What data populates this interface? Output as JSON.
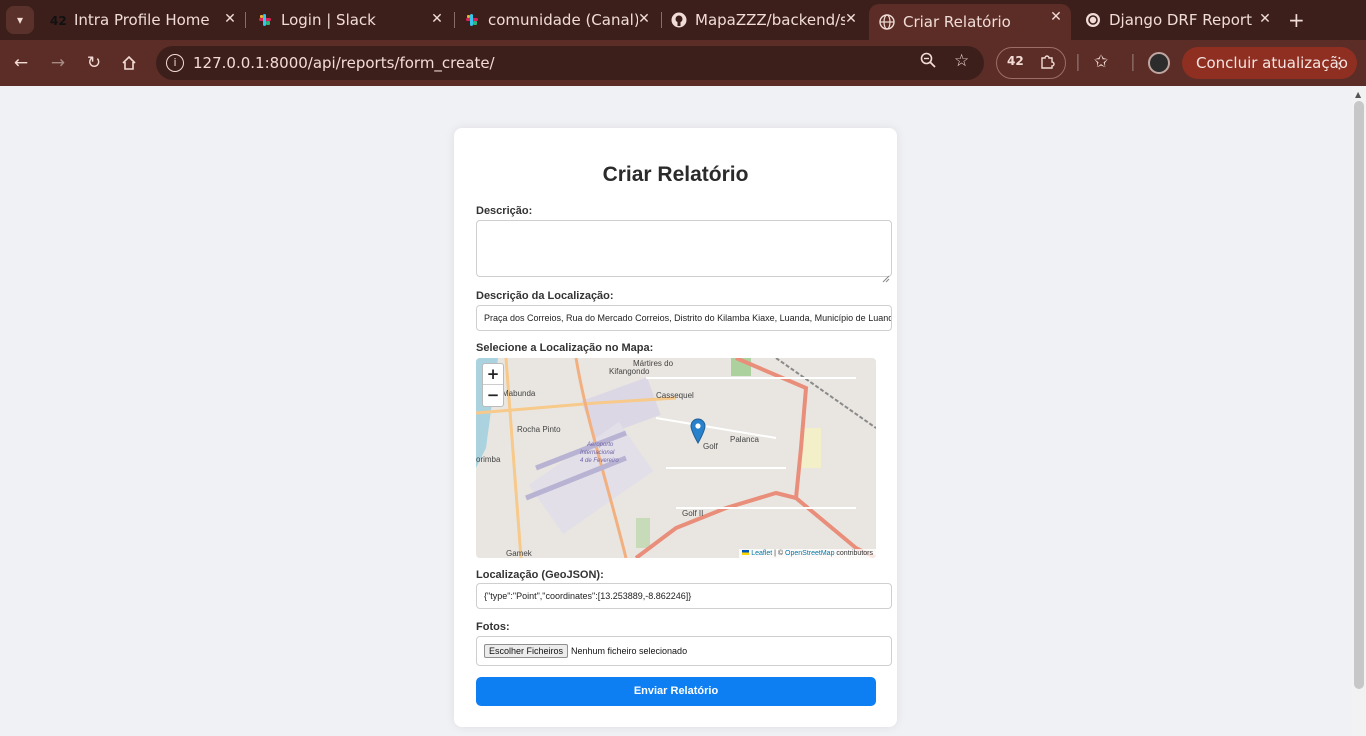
{
  "browser": {
    "tabs": [
      {
        "title": "Intra Profile Home",
        "icon": "42-icon"
      },
      {
        "title": "Login | Slack",
        "icon": "slack-icon"
      },
      {
        "title": "comunidade (Canal)",
        "icon": "slack-icon"
      },
      {
        "title": "MapaZZZ/backend/s",
        "icon": "github-icon"
      },
      {
        "title": "Criar Relatório",
        "icon": "globe-icon"
      },
      {
        "title": "Django DRF Report",
        "icon": "openai-icon"
      }
    ],
    "url": "127.0.0.1:8000/api/reports/form_create/",
    "update_button": "Concluir atualização",
    "colors": {
      "frame": "#3c1f1b",
      "toolbar": "#5b2d26",
      "update": "#8e2f22"
    }
  },
  "form": {
    "title": "Criar Relatório",
    "description_label": "Descrição:",
    "description_value": "",
    "location_description_label": "Descrição da Localização:",
    "location_description_value": "Praça dos Correios, Rua do Mercado Correios, Distrito do Kilamba Kiaxe, Luanda, Município de Luanda",
    "map_label": "Selecione a Localização no Mapa:",
    "geojson_label": "Localização (GeoJSON):",
    "geojson_value": "{\"type\":\"Point\",\"coordinates\":[13.253889,-8.862246]}",
    "photos_label": "Fotos:",
    "file_button": "Escolher Ficheiros",
    "file_status": "Nenhum ficheiro selecionado",
    "submit": "Enviar Relatório",
    "accent_color": "#0d7ff2"
  },
  "map": {
    "zoom_in": "+",
    "zoom_out": "−",
    "attribution_leaflet": "Leaflet",
    "attribution_sep": " | © ",
    "attribution_osm": "OpenStreetMap",
    "attribution_tail": " contributors",
    "places": {
      "marcos": "Mártires do",
      "kifangondo": "Kifangondo",
      "mabunda": "Mabunda",
      "cassequel": "Cassequel",
      "rocha_pinto": "Rocha Pinto",
      "palanca": "Palanca",
      "golf": "Golf",
      "corimba": "orimba",
      "golf2": "Golf II",
      "gamek": "Gamek",
      "airport1": "Aeroporto",
      "airport2": "Internacional",
      "airport3": "4 de Fevereiro"
    }
  }
}
